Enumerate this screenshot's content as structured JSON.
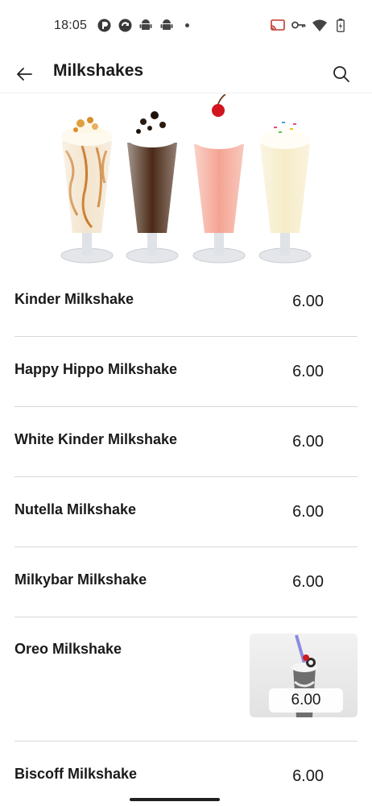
{
  "status_bar": {
    "time": "18:05",
    "left_icons": [
      "app-circle-icon",
      "sync-icon",
      "android-icon",
      "android-icon"
    ],
    "right_icons": [
      "cast-icon",
      "key-icon",
      "wifi-icon",
      "battery-icon"
    ]
  },
  "app_bar": {
    "title": "Milkshakes",
    "back_icon": "arrow-left-icon",
    "search_icon": "search-icon"
  },
  "menu": {
    "items": [
      {
        "name": "Kinder Milkshake",
        "price": "6.00"
      },
      {
        "name": "Happy Hippo Milkshake",
        "price": "6.00"
      },
      {
        "name": "White Kinder Milkshake",
        "price": "6.00"
      },
      {
        "name": "Nutella Milkshake",
        "price": "6.00"
      },
      {
        "name": "Milkybar Milkshake",
        "price": "6.00"
      },
      {
        "name": "Oreo Milkshake",
        "price": "6.00",
        "has_image": true
      },
      {
        "name": "Biscoff Milkshake",
        "price": "6.00"
      }
    ]
  },
  "colors": {
    "text": "#1a1a1a",
    "divider": "#d8d8d8",
    "background": "#ffffff"
  }
}
